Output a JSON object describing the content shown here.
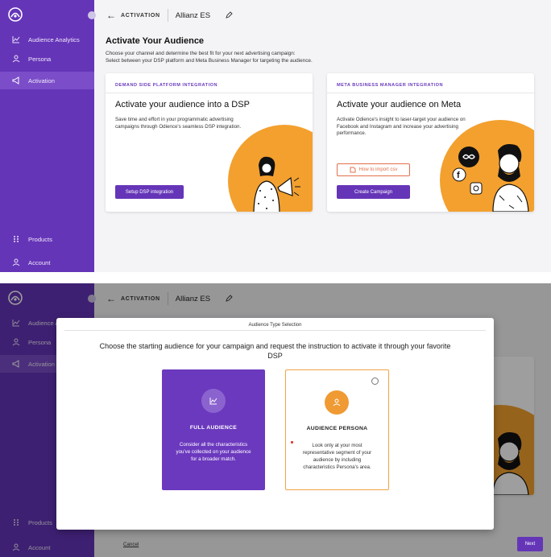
{
  "nav": {
    "items": [
      {
        "label": "Audience Analytics",
        "icon": "chart-line-icon"
      },
      {
        "label": "Persona",
        "icon": "persona-icon"
      },
      {
        "label": "Activation",
        "icon": "megaphone-icon"
      }
    ],
    "products_label": "Products",
    "account_label": "Account"
  },
  "header": {
    "crumb": "ACTIVATION",
    "brand": "Allianz ES"
  },
  "page": {
    "title": "Activate Your Audience",
    "subtitle_line1": "Choose your channel and determine the best fit for your next advertising campaign:",
    "subtitle_line2": "Select between your DSP platform and Meta Business Manager for targeting the audience."
  },
  "cards": {
    "dsp": {
      "tag": "DEMAND SIDE PLATFORM INTEGRATION",
      "title": "Activate your audience into a DSP",
      "desc": "Save time and effort in your programmatic advertising campaigns through Odience's seamless DSP integration.",
      "button": "Setup DSP integration"
    },
    "meta": {
      "tag": "META BUSINESS MANAGER INTEGRATION",
      "title": "Activate your audience on Meta",
      "desc": "Activate Odience's insight to laser-target your audience on Facebook and Instagram and increase your advertising performance.",
      "import_button": "How to import csv",
      "create_button": "Create Campaign"
    }
  },
  "modal": {
    "title": "Audience Type Selection",
    "question": "Choose the starting audience for your campaign and request the instruction to activate it through your favorite DSP",
    "full": {
      "title": "FULL AUDIENCE",
      "desc": "Consider all the characteristics you've collected on your audience for a broader match."
    },
    "persona": {
      "title": "AUDIENCE PERSONA",
      "desc": "Look only at your most representative segment of your audience by including characteristics Persona's area."
    },
    "cancel": "Cancel",
    "next": "Next"
  },
  "colors": {
    "primary": "#6535b8",
    "accent": "#f3a02f",
    "meta_outline": "#e2704c"
  }
}
